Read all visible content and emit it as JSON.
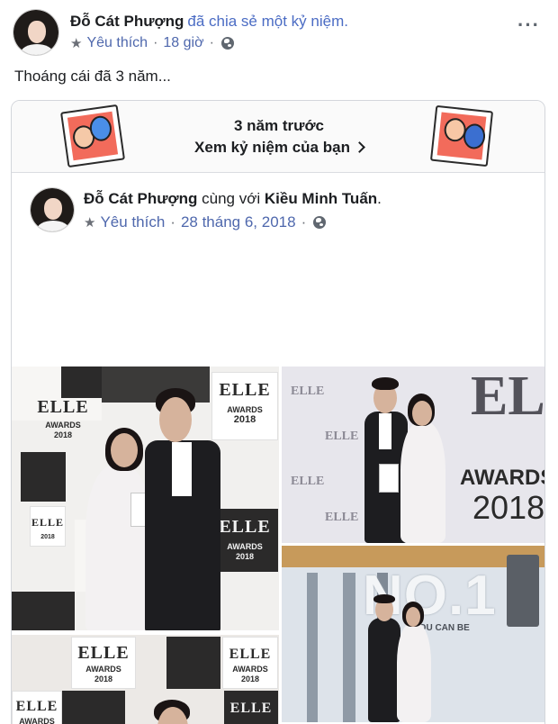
{
  "post": {
    "author": "Đỗ Cát Phượng",
    "action": "đã chia sẻ một kỷ niệm.",
    "favorite_label": "Yêu thích",
    "time": "18 giờ",
    "separator": "·",
    "text": "Thoáng cái đã 3 năm..."
  },
  "memory": {
    "title": "3 năm trước",
    "link_label": "Xem kỷ niệm của bạn"
  },
  "shared": {
    "author": "Đỗ Cát Phượng",
    "with_label": "cùng với",
    "tagged": "Kiều Minh Tuấn",
    "period": ".",
    "favorite_label": "Yêu thích",
    "date": "28 tháng 6, 2018",
    "separator": "·"
  },
  "photos": {
    "brand": "ELLE",
    "awards": "AWARDS",
    "year": "2018",
    "no1_text": "NO.1",
    "tagline": "YOU CAN BE"
  },
  "icons": {
    "star": "star-icon",
    "globe": "globe-icon",
    "more": "more-horizontal-icon",
    "chevron": "chevron-right-icon"
  },
  "colors": {
    "link_blue": "#4f68ad",
    "text": "#1c1e21",
    "muted": "#606770",
    "card_border": "#d3d6db"
  }
}
